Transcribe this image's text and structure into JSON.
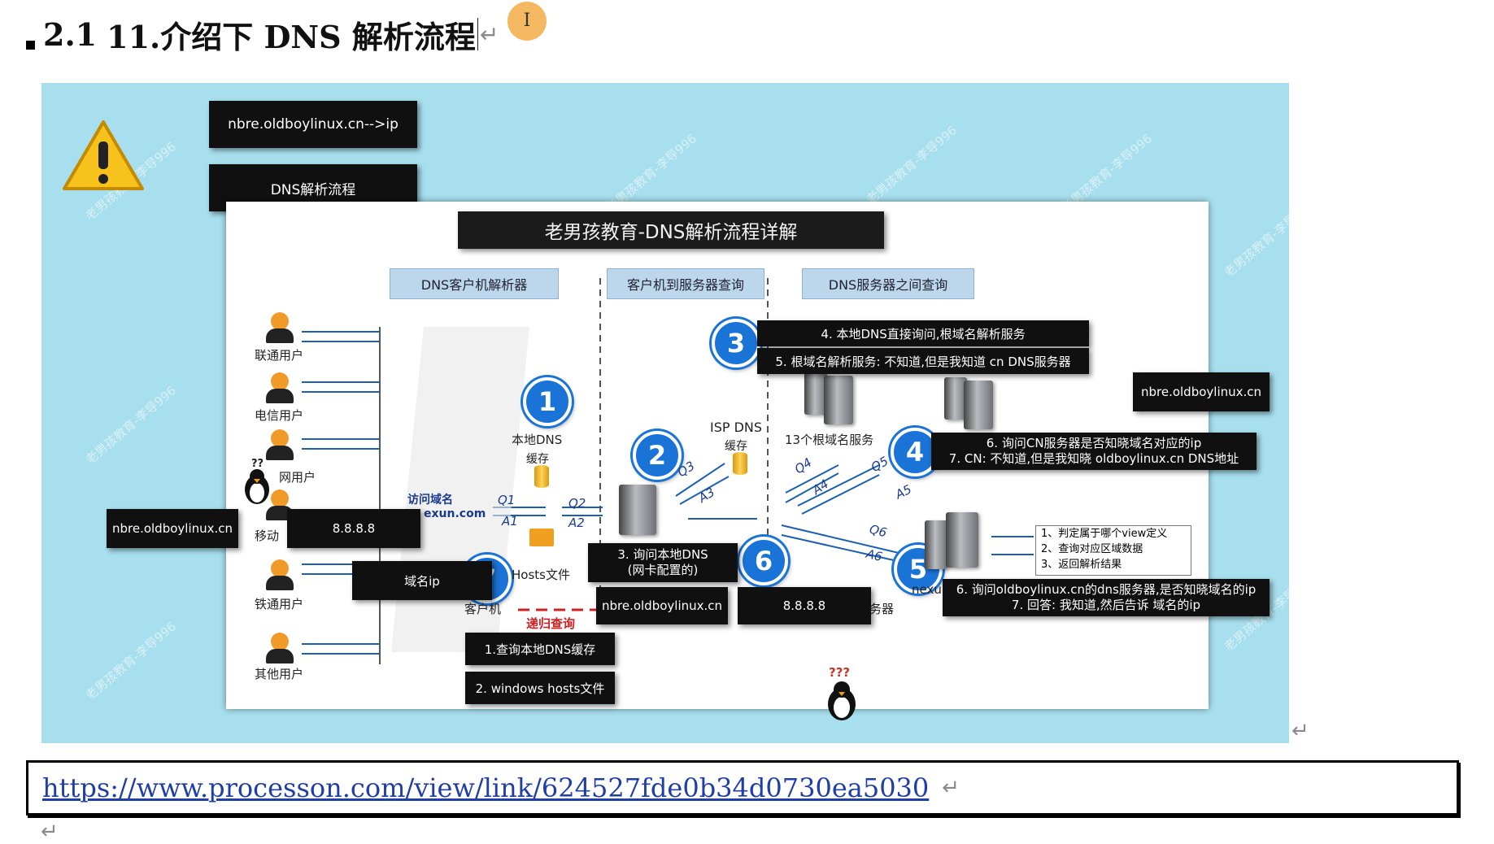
{
  "heading": {
    "number": "2.1",
    "text": "11.介绍下 DNS 解析流程",
    "cursor_icon": "I"
  },
  "return_mark": "↵",
  "diagram": {
    "top_boxes": [
      "nbre.oldboylinux.cn-->ip",
      "DNS解析流程"
    ],
    "title": "老男孩教育-DNS解析流程详解",
    "section_headers": [
      "DNS客户机解析器",
      "客户机到服务器查询",
      "DNS服务器之间查询"
    ],
    "users": [
      "联通用户",
      "电信用户",
      "网用户",
      "移动",
      "铁通用户",
      "其他用户"
    ],
    "local_dns": [
      "本地DNS",
      "缓存"
    ],
    "isp_dns": [
      "ISP DNS",
      "缓存"
    ],
    "root_servers": "13个根域名服务",
    "visit_domain": "访问域名",
    "domain_partial": "exun.com",
    "hosts_file": "Hosts文件",
    "client": "客户机",
    "recursive": "递归查询",
    "server_suffix": "务器",
    "nexu_partial": "nexu",
    "qa_labels": [
      "Q1",
      "A1",
      "Q2",
      "A2",
      "Q3",
      "A3",
      "Q4",
      "A4",
      "Q5",
      "A5",
      "Q6",
      "A6"
    ],
    "numbers": [
      "1",
      "2",
      "3",
      "4",
      "5",
      "6",
      "7"
    ],
    "black_boxes": {
      "step3_a": "4. 本地DNS直接询问,根域名解析服务",
      "step3_b": "5. 根域名解析服务: 不知道,但是我知道 cn DNS服务器",
      "right_domain": "nbre.oldboylinux.cn",
      "step4_a": "6. 询问CN服务器是否知晓域名对应的ip",
      "step4_b": "7. CN: 不知道,但是我知晓 oldboylinux.cn DNS地址",
      "left_domain": "nbre.oldboylinux.cn",
      "dns_888_left": "8.8.8.8",
      "domain_ip": "域名ip",
      "step3_query_a": "3. 询问本地DNS",
      "step3_query_b": "(网卡配置的)",
      "mid_domain": "nbre.oldboylinux.cn",
      "dns_888_mid": "8.8.8.8",
      "step5_a": "6. 询问oldboylinux.cn的dns服务器,是否知晓域名的ip",
      "step5_b": "7. 回答: 我知道,然后告诉 域名的ip",
      "local_cache": "1.查询本地DNS缓存",
      "hosts_win": "2. windows hosts文件"
    },
    "resolve_steps": [
      "1、判定属于哪个view定义",
      "2、查询对应区域数据",
      "3、返回解析结果"
    ],
    "watermark": "老男孩教育-李导996",
    "icons": [
      "warning-icon",
      "penguin-icon",
      "server-icon",
      "database-icon",
      "folder-icon",
      "user-icon"
    ]
  },
  "link": {
    "url": "https://www.processon.com/view/link/624527fde0b34d0730ea5030"
  }
}
